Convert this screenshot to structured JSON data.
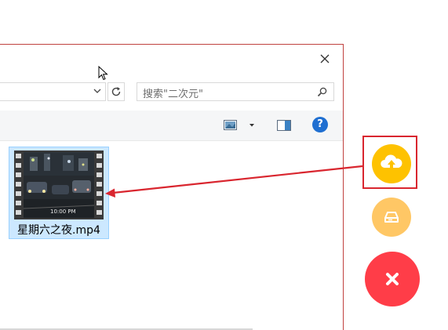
{
  "search": {
    "placeholder": "搜索\"二次元\""
  },
  "file": {
    "name": "星期六之夜.mp4",
    "thumbnail_caption": "10:00 PM"
  },
  "toolbar": {
    "help_label": "?"
  },
  "icons": {
    "close": "close-icon",
    "chevron": "chevron-down-icon",
    "refresh": "refresh-icon",
    "search": "search-icon",
    "view": "view-options-icon",
    "pane": "preview-pane-icon",
    "help": "help-icon",
    "upload": "cloud-upload-icon",
    "drive": "hard-drive-icon",
    "fab_close": "close-icon",
    "cursor": "mouse-cursor-icon"
  },
  "colors": {
    "window_border": "#c0413f",
    "selection_bg": "#cce8ff",
    "selection_border": "#99d1ff",
    "upload_fab": "#fec200",
    "drive_fab": "#ffc765",
    "close_fab": "#ff3d48",
    "annotation_red": "#d9262f",
    "help_blue": "#1f6fd1"
  }
}
